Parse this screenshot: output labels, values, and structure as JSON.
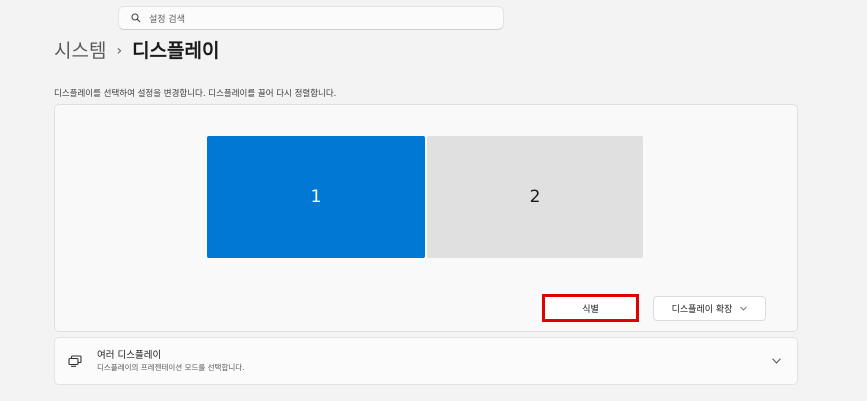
{
  "search": {
    "placeholder": "설정 검색",
    "icon": "search-icon"
  },
  "breadcrumb": {
    "parent": "시스템",
    "separator": "›",
    "current": "디스플레이"
  },
  "description": "디스플레이를 선택하여 설정을 변경합니다. 디스플레이를 끌어 다시 정렬합니다.",
  "arrangement": {
    "monitors": [
      {
        "label": "1",
        "selected": true
      },
      {
        "label": "2",
        "selected": false
      }
    ],
    "identify_label": "식별",
    "mode_value": "디스플레이 확장",
    "accent_color": "#0078d4",
    "highlight_color": "#e00000"
  },
  "multi_display": {
    "title": "여러 디스플레이",
    "subtitle": "디스플레이의 프레젠테이션 모드를 선택합니다.",
    "icon": "multi-display-icon"
  }
}
